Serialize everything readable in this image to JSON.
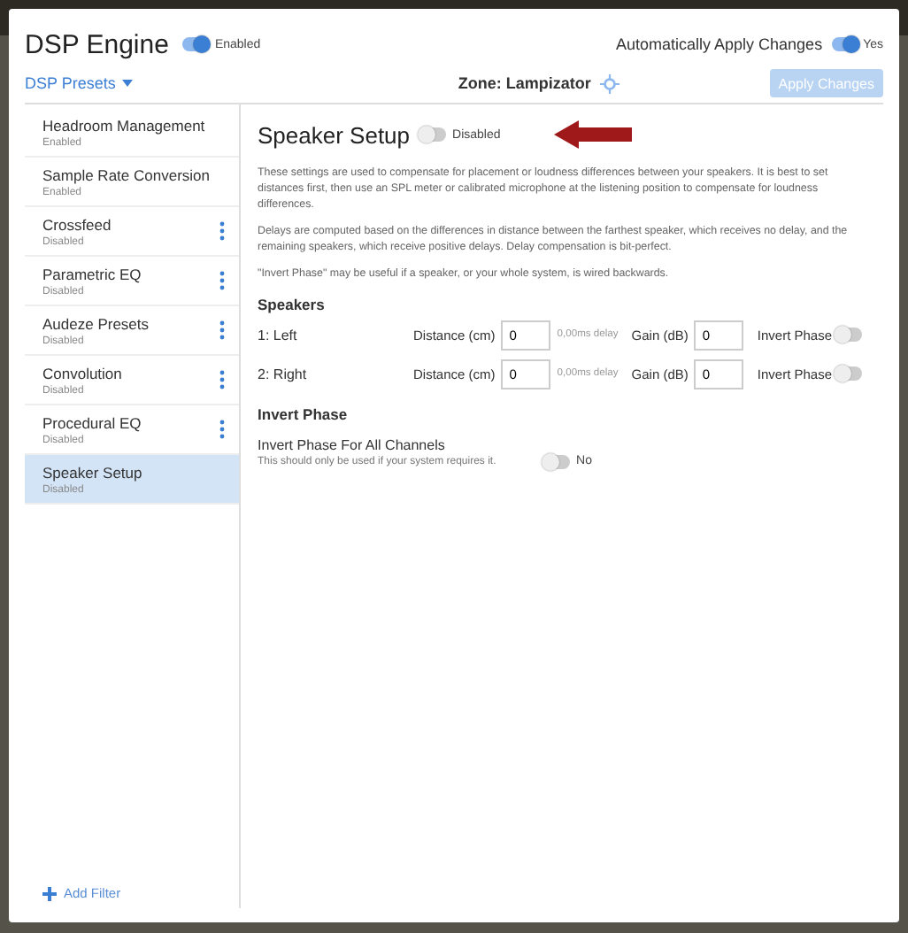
{
  "header": {
    "title": "DSP Engine",
    "engine_toggle": {
      "on": true,
      "label": "Enabled"
    },
    "auto_apply": {
      "label": "Automatically Apply Changes",
      "on": true,
      "state": "Yes"
    }
  },
  "presets": "DSP Presets",
  "zone": "Zone: Lampizator",
  "apply_button": {
    "label": "Apply Changes",
    "disabled": true
  },
  "filters": [
    {
      "name": "Headroom Management",
      "status": "Enabled",
      "has_menu": false,
      "selected": false
    },
    {
      "name": "Sample Rate Conversion",
      "status": "Enabled",
      "has_menu": false,
      "selected": false
    },
    {
      "name": "Crossfeed",
      "status": "Disabled",
      "has_menu": true,
      "selected": false
    },
    {
      "name": "Parametric EQ",
      "status": "Disabled",
      "has_menu": true,
      "selected": false
    },
    {
      "name": "Audeze Presets",
      "status": "Disabled",
      "has_menu": true,
      "selected": false
    },
    {
      "name": "Convolution",
      "status": "Disabled",
      "has_menu": true,
      "selected": false
    },
    {
      "name": "Procedural EQ",
      "status": "Disabled",
      "has_menu": true,
      "selected": false
    },
    {
      "name": "Speaker Setup",
      "status": "Disabled",
      "has_menu": false,
      "selected": true
    }
  ],
  "add_filter": "Add Filter",
  "panel": {
    "title": "Speaker Setup",
    "toggle": {
      "on": false,
      "label": "Disabled"
    },
    "paragraphs": [
      "These settings are used to compensate for placement or loudness differences between your speakers. It is best to set distances first, then use an SPL meter or calibrated microphone at the listening position to compensate for loudness differences.",
      "Delays are computed based on the differences in distance between the farthest speaker, which receives no delay, and the remaining speakers, which receive positive delays. Delay compensation is bit-perfect.",
      "\"Invert Phase\" may be useful if a speaker, or your whole system, is wired backwards."
    ],
    "speakers_heading": "Speakers",
    "speakers": [
      {
        "name": "1: Left",
        "distance_label": "Distance (cm)",
        "distance": "0",
        "delay": "0,00ms delay",
        "gain_label": "Gain (dB)",
        "gain": "0",
        "invert_label": "Invert Phase",
        "invert": false
      },
      {
        "name": "2: Right",
        "distance_label": "Distance (cm)",
        "distance": "0",
        "delay": "0,00ms delay",
        "gain_label": "Gain (dB)",
        "gain": "0",
        "invert_label": "Invert Phase",
        "invert": false
      }
    ],
    "invert_heading": "Invert Phase",
    "invert_all": {
      "label": "Invert Phase For All Channels",
      "hint": "This should only be used if your system requires it.",
      "on": false,
      "state": "No"
    }
  }
}
